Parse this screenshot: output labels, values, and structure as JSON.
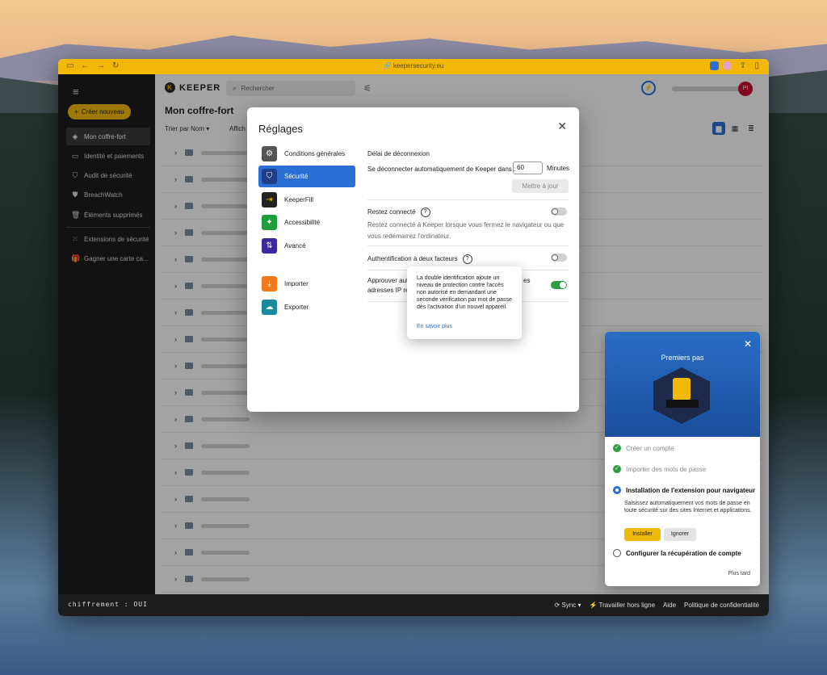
{
  "browser": {
    "url": "keepersecurity.eu"
  },
  "sidebar": {
    "create_label": "Créer nouveau",
    "items": [
      {
        "label": "Mon coffre-fort",
        "icon": "vault-icon"
      },
      {
        "label": "Identité et paiements",
        "icon": "card-icon"
      },
      {
        "label": "Audit de sécurité",
        "icon": "shield-icon"
      },
      {
        "label": "BreachWatch",
        "icon": "breachwatch-icon"
      },
      {
        "label": "Éléments supprimés",
        "icon": "trash-icon"
      },
      {
        "label": "Extensions de sécurité",
        "icon": "grid-icon"
      },
      {
        "label": "Gagner une carte ca...",
        "icon": "gift-icon"
      }
    ]
  },
  "header": {
    "brand": "KEEPER",
    "search_placeholder": "Rechercher",
    "avatar_initials": "PI"
  },
  "vault": {
    "title": "Mon coffre-fort",
    "sort_label": "Trier par Nom",
    "display_label": "Affich"
  },
  "statusbar": {
    "encryption": "chiffrement : OUI",
    "sync": "Sync",
    "offline": "Travailler hors ligne",
    "help": "Aide",
    "privacy": "Politique de confidentialité"
  },
  "settings": {
    "title": "Réglages",
    "menu": [
      {
        "label": "Conditions générales",
        "icon": "gear-icon",
        "color": "#555555"
      },
      {
        "label": "Sécurité",
        "icon": "shield-icon",
        "color": "#1f3f8a"
      },
      {
        "label": "KeeperFill",
        "icon": "keeperfill-icon",
        "color": "#222222"
      },
      {
        "label": "Accessibilité",
        "icon": "accessibility-icon",
        "color": "#1f9d3a"
      },
      {
        "label": "Avancé",
        "icon": "sliders-icon",
        "color": "#3b2a9e"
      },
      {
        "label": "Importer",
        "icon": "import-icon",
        "color": "#f27a1a"
      },
      {
        "label": "Exporter",
        "icon": "export-icon",
        "color": "#1a8a9e"
      }
    ],
    "logout": {
      "heading": "Délai de déconnexion",
      "label": "Se déconnecter automatiquement de Keeper dans :",
      "value": "60",
      "unit": "Minutes",
      "button": "Mettre à jour"
    },
    "stay": {
      "label": "Restez connecté",
      "desc": "Restez connecté à Keeper lorsque vous fermez le navigateur ou que vous redémarrez l'ordinateur."
    },
    "twofa": {
      "label": "Authentification à deux facteurs"
    },
    "approve": {
      "label_a": "Approuver aut",
      "label_b": "es",
      "label_c": "adresses IP rec"
    }
  },
  "tooltip": {
    "text": "La double identification ajoute un niveau de protection contre l'accès non autorisé en demandant une seconde vérification par mot de passe dès l'activation d'un nouvel appareil.",
    "link": "En savoir plus"
  },
  "getting_started": {
    "title": "Premiers pas",
    "steps": [
      {
        "label": "Créer un compte"
      },
      {
        "label": "Importer des mots de passe"
      },
      {
        "label": "Installation de l'extension pour navigateur"
      },
      {
        "label": "Configurer la récupération de compte"
      }
    ],
    "desc": "Saisissez automatiquement vos mots de passe en toute sécurité sur des sites Internet et applications.",
    "install": "Installer",
    "ignore": "Ignorer",
    "later": "Plus tard"
  },
  "colors": {
    "accent": "#f2b807",
    "primary": "#2b6fd6",
    "toggle_on": "#2e9e46"
  }
}
